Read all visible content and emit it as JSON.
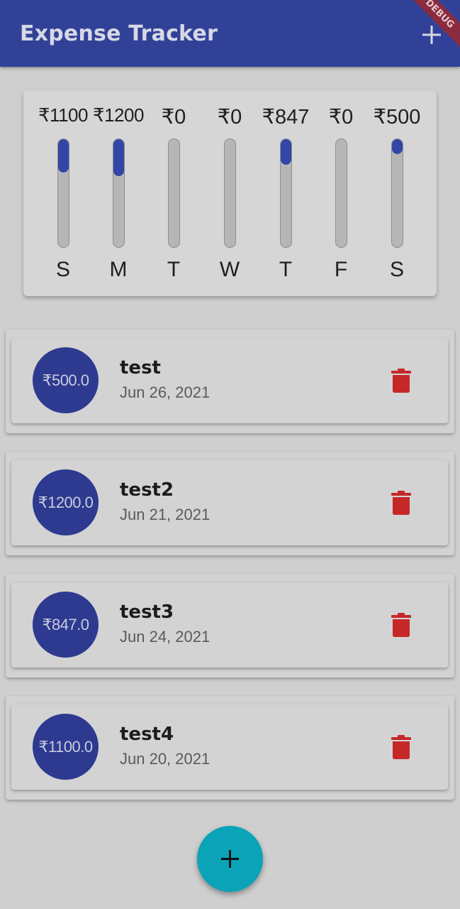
{
  "app_bar": {
    "title": "Expense Tracker",
    "add_icon": "plus-icon",
    "debug_banner": "DEBUG"
  },
  "colors": {
    "app_bar": "#324198",
    "bar_fill": "#3346a5",
    "avatar": "#2d3a8f",
    "delete": "#c62828",
    "fab": "#0aa3b8"
  },
  "chart": {
    "bars": [
      {
        "day": "S",
        "amount": "₹1100",
        "fraction": 0.31
      },
      {
        "day": "M",
        "amount": "₹1200",
        "fraction": 0.34
      },
      {
        "day": "T",
        "amount": "₹0",
        "fraction": 0
      },
      {
        "day": "W",
        "amount": "₹0",
        "fraction": 0
      },
      {
        "day": "T",
        "amount": "₹847",
        "fraction": 0.24
      },
      {
        "day": "F",
        "amount": "₹0",
        "fraction": 0
      },
      {
        "day": "S",
        "amount": "₹500",
        "fraction": 0.14
      }
    ]
  },
  "transactions": [
    {
      "amount": "₹500.0",
      "title": "test",
      "date": "Jun 26, 2021",
      "delete_icon": "trash-icon"
    },
    {
      "amount": "₹1200.0",
      "title": "test2",
      "date": "Jun 21, 2021",
      "delete_icon": "trash-icon"
    },
    {
      "amount": "₹847.0",
      "title": "test3",
      "date": "Jun 24, 2021",
      "delete_icon": "trash-icon"
    },
    {
      "amount": "₹1100.0",
      "title": "test4",
      "date": "Jun 20, 2021",
      "delete_icon": "trash-icon"
    }
  ],
  "fab": {
    "icon": "plus-icon"
  }
}
